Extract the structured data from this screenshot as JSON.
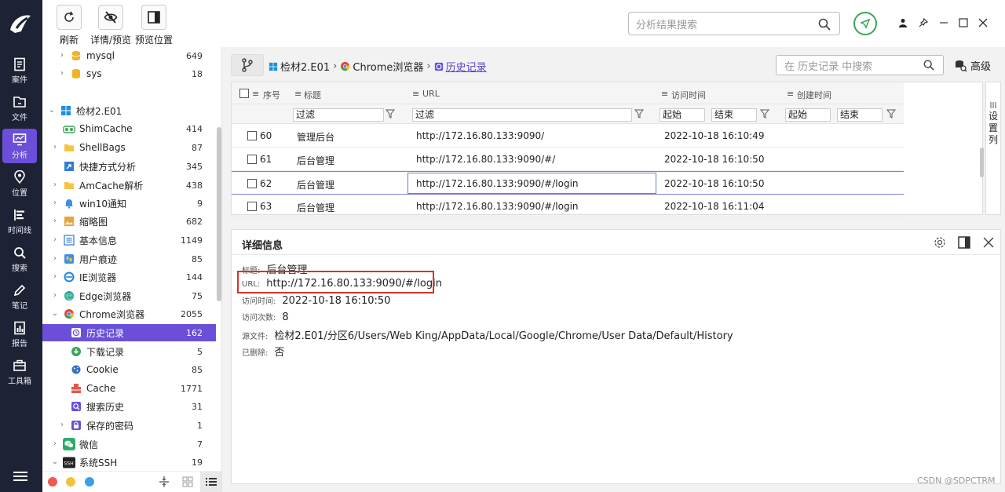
{
  "toolbar": {
    "refresh": "刷新",
    "detail_preview": "详情/预览",
    "preview_position": "预览位置",
    "search_placeholder": "分析结果搜索"
  },
  "rail": {
    "items": [
      {
        "label": "案件",
        "icon": "case-icon"
      },
      {
        "label": "文件",
        "icon": "folder-icon"
      },
      {
        "label": "分析",
        "icon": "analysis-icon"
      },
      {
        "label": "位置",
        "icon": "location-icon"
      },
      {
        "label": "时间线",
        "icon": "timeline-icon"
      },
      {
        "label": "搜索",
        "icon": "search-icon"
      },
      {
        "label": "笔记",
        "icon": "note-icon"
      },
      {
        "label": "报告",
        "icon": "report-icon"
      },
      {
        "label": "工具箱",
        "icon": "toolbox-icon"
      }
    ]
  },
  "tree": {
    "items": [
      {
        "label": "mysql",
        "count": "649"
      },
      {
        "label": "sys",
        "count": "18"
      },
      {
        "label": "检材2.E01",
        "count": ""
      },
      {
        "label": "ShimCache",
        "count": "414"
      },
      {
        "label": "ShellBags",
        "count": "87"
      },
      {
        "label": "快捷方式分析",
        "count": "345"
      },
      {
        "label": "AmCache解析",
        "count": "438"
      },
      {
        "label": "win10通知",
        "count": "9"
      },
      {
        "label": "缩略图",
        "count": "682"
      },
      {
        "label": "基本信息",
        "count": "1149"
      },
      {
        "label": "用户痕迹",
        "count": "85"
      },
      {
        "label": "IE浏览器",
        "count": "144"
      },
      {
        "label": "Edge浏览器",
        "count": "75"
      },
      {
        "label": "Chrome浏览器",
        "count": "2055"
      },
      {
        "label": "历史记录",
        "count": "162"
      },
      {
        "label": "下载记录",
        "count": "5"
      },
      {
        "label": "Cookie",
        "count": "85"
      },
      {
        "label": "Cache",
        "count": "1771"
      },
      {
        "label": "搜索历史",
        "count": "31"
      },
      {
        "label": "保存的密码",
        "count": "1"
      },
      {
        "label": "微信",
        "count": "7"
      },
      {
        "label": "系统SSH",
        "count": "19"
      }
    ]
  },
  "breadcrumb": {
    "root": "检材2.E01",
    "mid": "Chrome浏览器",
    "current": "历史记录"
  },
  "history_search": {
    "placeholder": "在 历史记录 中搜索",
    "advanced": "高级"
  },
  "table": {
    "headers": {
      "seq": "序号",
      "title": "标题",
      "url": "URL",
      "visit_time": "访问时间",
      "create_time": "创建时间"
    },
    "filter": "过滤",
    "start": "起始",
    "end": "结束",
    "settings_col": "设置列",
    "rows": [
      {
        "seq": "60",
        "title": "管理后台",
        "url": "http://172.16.80.133:9090/",
        "time": "2022-10-18 16:10:49"
      },
      {
        "seq": "61",
        "title": "后台管理",
        "url": "http://172.16.80.133:9090/#/",
        "time": "2022-10-18 16:10:50"
      },
      {
        "seq": "62",
        "title": "后台管理",
        "url": "http://172.16.80.133:9090/#/login",
        "time": "2022-10-18 16:10:50"
      },
      {
        "seq": "63",
        "title": "后台管理",
        "url": "http://172.16.80.133:9090/#/login",
        "time": "2022-10-18 16:11:04"
      }
    ]
  },
  "detail": {
    "title": "详细信息",
    "fields": [
      {
        "key": "标题:",
        "value": "后台管理"
      },
      {
        "key": "URL:",
        "value": "http://172.16.80.133:9090/#/login"
      },
      {
        "key": "访问时间:",
        "value": "2022-10-18 16:10:50"
      },
      {
        "key": "访问次数:",
        "value": "8"
      },
      {
        "key": "源文件:",
        "value": "检材2.E01/分区6/Users/Web King/AppData/Local/Google/Chrome/User Data/Default/History"
      },
      {
        "key": "已删除:",
        "value": "否"
      }
    ]
  },
  "watermark": "CSDN @SDPCTRM",
  "colors": {
    "accent": "#6b4fd8",
    "rail": "#1e2235",
    "highlight": "#d9302c",
    "send": "#3aa557"
  }
}
